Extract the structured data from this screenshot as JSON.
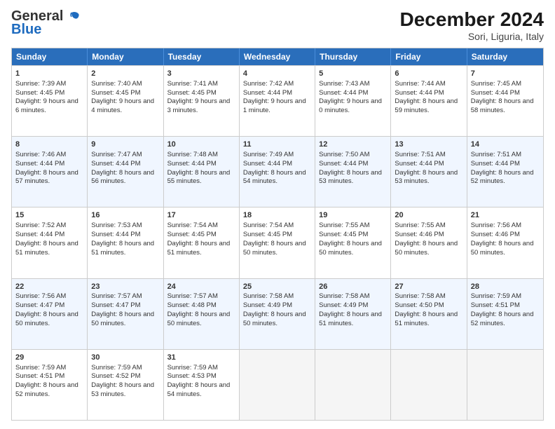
{
  "logo": {
    "line1": "General",
    "line2": "Blue"
  },
  "title": "December 2024",
  "subtitle": "Sori, Liguria, Italy",
  "days": [
    "Sunday",
    "Monday",
    "Tuesday",
    "Wednesday",
    "Thursday",
    "Friday",
    "Saturday"
  ],
  "weeks": [
    [
      {
        "num": "1",
        "sunrise": "7:39 AM",
        "sunset": "4:45 PM",
        "daylight": "9 hours and 6 minutes."
      },
      {
        "num": "2",
        "sunrise": "7:40 AM",
        "sunset": "4:45 PM",
        "daylight": "9 hours and 4 minutes."
      },
      {
        "num": "3",
        "sunrise": "7:41 AM",
        "sunset": "4:45 PM",
        "daylight": "9 hours and 3 minutes."
      },
      {
        "num": "4",
        "sunrise": "7:42 AM",
        "sunset": "4:44 PM",
        "daylight": "9 hours and 1 minute."
      },
      {
        "num": "5",
        "sunrise": "7:43 AM",
        "sunset": "4:44 PM",
        "daylight": "9 hours and 0 minutes."
      },
      {
        "num": "6",
        "sunrise": "7:44 AM",
        "sunset": "4:44 PM",
        "daylight": "8 hours and 59 minutes."
      },
      {
        "num": "7",
        "sunrise": "7:45 AM",
        "sunset": "4:44 PM",
        "daylight": "8 hours and 58 minutes."
      }
    ],
    [
      {
        "num": "8",
        "sunrise": "7:46 AM",
        "sunset": "4:44 PM",
        "daylight": "8 hours and 57 minutes."
      },
      {
        "num": "9",
        "sunrise": "7:47 AM",
        "sunset": "4:44 PM",
        "daylight": "8 hours and 56 minutes."
      },
      {
        "num": "10",
        "sunrise": "7:48 AM",
        "sunset": "4:44 PM",
        "daylight": "8 hours and 55 minutes."
      },
      {
        "num": "11",
        "sunrise": "7:49 AM",
        "sunset": "4:44 PM",
        "daylight": "8 hours and 54 minutes."
      },
      {
        "num": "12",
        "sunrise": "7:50 AM",
        "sunset": "4:44 PM",
        "daylight": "8 hours and 53 minutes."
      },
      {
        "num": "13",
        "sunrise": "7:51 AM",
        "sunset": "4:44 PM",
        "daylight": "8 hours and 53 minutes."
      },
      {
        "num": "14",
        "sunrise": "7:51 AM",
        "sunset": "4:44 PM",
        "daylight": "8 hours and 52 minutes."
      }
    ],
    [
      {
        "num": "15",
        "sunrise": "7:52 AM",
        "sunset": "4:44 PM",
        "daylight": "8 hours and 51 minutes."
      },
      {
        "num": "16",
        "sunrise": "7:53 AM",
        "sunset": "4:44 PM",
        "daylight": "8 hours and 51 minutes."
      },
      {
        "num": "17",
        "sunrise": "7:54 AM",
        "sunset": "4:45 PM",
        "daylight": "8 hours and 51 minutes."
      },
      {
        "num": "18",
        "sunrise": "7:54 AM",
        "sunset": "4:45 PM",
        "daylight": "8 hours and 50 minutes."
      },
      {
        "num": "19",
        "sunrise": "7:55 AM",
        "sunset": "4:45 PM",
        "daylight": "8 hours and 50 minutes."
      },
      {
        "num": "20",
        "sunrise": "7:55 AM",
        "sunset": "4:46 PM",
        "daylight": "8 hours and 50 minutes."
      },
      {
        "num": "21",
        "sunrise": "7:56 AM",
        "sunset": "4:46 PM",
        "daylight": "8 hours and 50 minutes."
      }
    ],
    [
      {
        "num": "22",
        "sunrise": "7:56 AM",
        "sunset": "4:47 PM",
        "daylight": "8 hours and 50 minutes."
      },
      {
        "num": "23",
        "sunrise": "7:57 AM",
        "sunset": "4:47 PM",
        "daylight": "8 hours and 50 minutes."
      },
      {
        "num": "24",
        "sunrise": "7:57 AM",
        "sunset": "4:48 PM",
        "daylight": "8 hours and 50 minutes."
      },
      {
        "num": "25",
        "sunrise": "7:58 AM",
        "sunset": "4:49 PM",
        "daylight": "8 hours and 50 minutes."
      },
      {
        "num": "26",
        "sunrise": "7:58 AM",
        "sunset": "4:49 PM",
        "daylight": "8 hours and 51 minutes."
      },
      {
        "num": "27",
        "sunrise": "7:58 AM",
        "sunset": "4:50 PM",
        "daylight": "8 hours and 51 minutes."
      },
      {
        "num": "28",
        "sunrise": "7:59 AM",
        "sunset": "4:51 PM",
        "daylight": "8 hours and 52 minutes."
      }
    ],
    [
      {
        "num": "29",
        "sunrise": "7:59 AM",
        "sunset": "4:51 PM",
        "daylight": "8 hours and 52 minutes."
      },
      {
        "num": "30",
        "sunrise": "7:59 AM",
        "sunset": "4:52 PM",
        "daylight": "8 hours and 53 minutes."
      },
      {
        "num": "31",
        "sunrise": "7:59 AM",
        "sunset": "4:53 PM",
        "daylight": "8 hours and 54 minutes."
      },
      null,
      null,
      null,
      null
    ]
  ]
}
